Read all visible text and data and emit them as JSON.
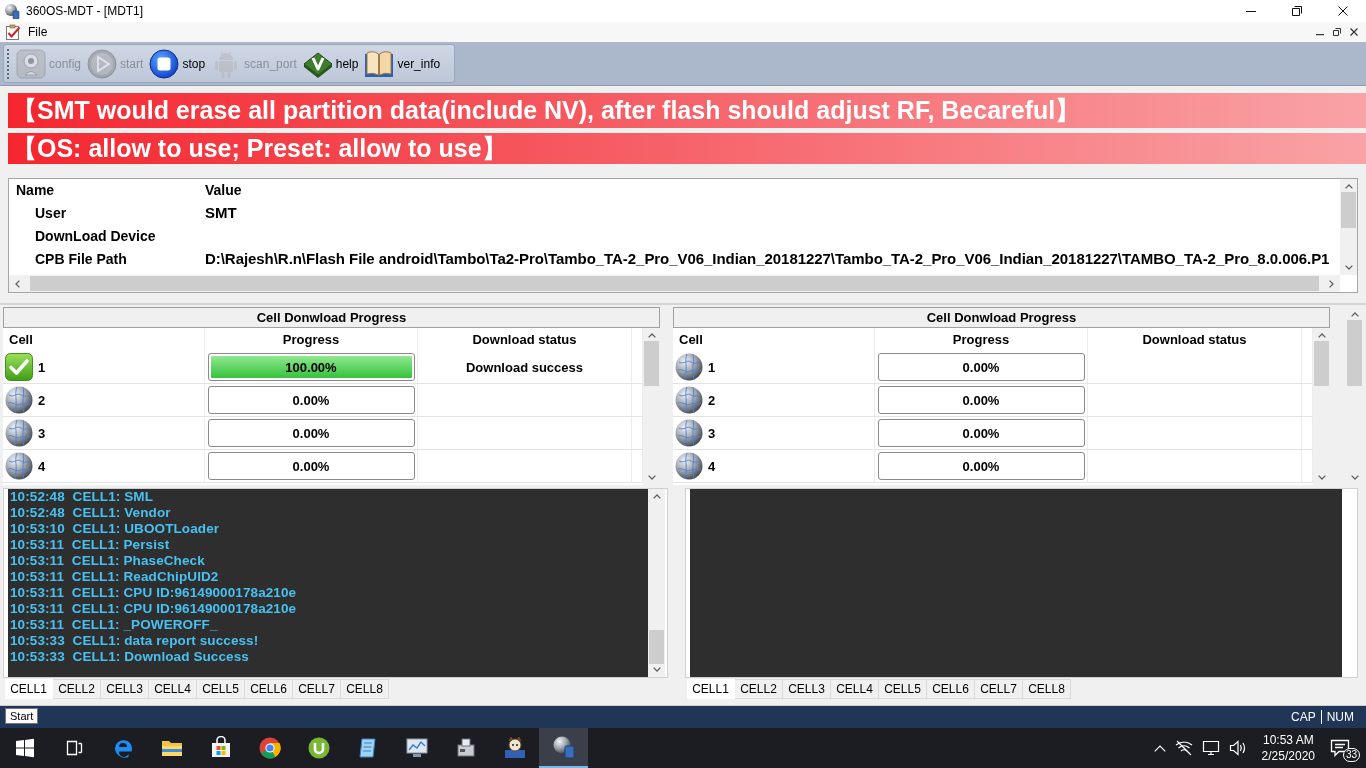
{
  "window": {
    "title": "360OS-MDT - [MDT1]"
  },
  "menu": [
    "File"
  ],
  "toolbar": [
    {
      "kind": "config",
      "label": "config",
      "disabled": true
    },
    {
      "kind": "start",
      "label": "start",
      "disabled": true
    },
    {
      "kind": "stop",
      "label": "stop",
      "disabled": false
    },
    {
      "kind": "scan",
      "label": "scan_port",
      "disabled": true
    },
    {
      "kind": "help",
      "label": "help",
      "disabled": false
    },
    {
      "kind": "info",
      "label": "ver_info",
      "disabled": false
    }
  ],
  "banners": [
    "【SMT would erase all partition data(include NV), after flash should adjust RF, Becareful】",
    "【OS: allow to use; Preset: allow to use】"
  ],
  "info_table": {
    "columns": [
      "Name",
      "Value"
    ],
    "rows": [
      {
        "name": "User",
        "value": "SMT"
      },
      {
        "name": "DownLoad Device"
      },
      {
        "name": "CPB File Path",
        "value": "D:\\Rajesh\\R.n\\Flash File android\\Tambo\\Ta2-Pro\\Tambo_TA-2_Pro_V06_Indian_20181227\\Tambo_TA-2_Pro_V06_Indian_20181227\\TAMBO_TA-2_Pro_8.0.006.P1"
      }
    ]
  },
  "progress_panels": [
    {
      "title": "Cell Donwload Progress",
      "columns": [
        "Cell",
        "Progress",
        "Download status"
      ],
      "rows": [
        {
          "cell": "1",
          "kind": "done",
          "level": 1,
          "reading": "100.00%",
          "status": "Download success"
        },
        {
          "cell": "2",
          "kind": "idle",
          "level": 0,
          "reading": "0.00%"
        },
        {
          "cell": "3",
          "kind": "idle",
          "level": 0,
          "reading": "0.00%"
        },
        {
          "cell": "4",
          "kind": "idle",
          "level": 0,
          "reading": "0.00%"
        }
      ]
    },
    {
      "title": "Cell Donwload Progress",
      "columns": [
        "Cell",
        "Progress",
        "Download status"
      ],
      "rows": [
        {
          "cell": "1",
          "kind": "idle",
          "level": 0,
          "reading": "0.00%"
        },
        {
          "cell": "2",
          "kind": "idle",
          "level": 0,
          "reading": "0.00%"
        },
        {
          "cell": "3",
          "kind": "idle",
          "level": 0,
          "reading": "0.00%"
        },
        {
          "cell": "4",
          "kind": "idle",
          "level": 0,
          "reading": "0.00%"
        }
      ]
    }
  ],
  "log_panels": [
    {
      "lines": [
        "10:52:48  CELL1: SML",
        "10:52:48  CELL1: Vendor",
        "10:53:10  CELL1: UBOOTLoader",
        "10:53:11  CELL1: Persist",
        "10:53:11  CELL1: PhaseCheck",
        "10:53:11  CELL1: ReadChipUID2",
        "10:53:11  CELL1: CPU ID:96149000178a210e",
        "10:53:11  CELL1: CPU ID:96149000178a210e",
        "10:53:11  CELL1: _POWEROFF_",
        "10:53:33  CELL1: data report success!",
        "10:53:33  CELL1: Download Success"
      ],
      "tabs": [
        {
          "label": "CELL1",
          "selected": true
        },
        {
          "label": "CELL2",
          "selected": false
        },
        {
          "label": "CELL3",
          "selected": false
        },
        {
          "label": "CELL4",
          "selected": false
        },
        {
          "label": "CELL5",
          "selected": false
        },
        {
          "label": "CELL6",
          "selected": false
        },
        {
          "label": "CELL7",
          "selected": false
        },
        {
          "label": "CELL8",
          "selected": false
        }
      ]
    },
    {
      "tabs": [
        {
          "label": "CELL1",
          "selected": true
        },
        {
          "label": "CELL2",
          "selected": false
        },
        {
          "label": "CELL3",
          "selected": false
        },
        {
          "label": "CELL4",
          "selected": false
        },
        {
          "label": "CELL5",
          "selected": false
        },
        {
          "label": "CELL6",
          "selected": false
        },
        {
          "label": "CELL7",
          "selected": false
        },
        {
          "label": "CELL8",
          "selected": false
        }
      ]
    }
  ],
  "tooltip": "Start",
  "status_bar": [
    "CAP",
    "NUM"
  ],
  "taskbar": {
    "apps": [
      {
        "kind": "start",
        "selected": false
      },
      {
        "kind": "taskview",
        "selected": false
      },
      {
        "kind": "browser",
        "selected": false
      },
      {
        "kind": "folder",
        "selected": false
      },
      {
        "kind": "store",
        "selected": false
      },
      {
        "kind": "chrome",
        "selected": false
      },
      {
        "kind": "torrent",
        "selected": false
      },
      {
        "kind": "notepad",
        "selected": false
      },
      {
        "kind": "monitor",
        "selected": false
      },
      {
        "kind": "device",
        "selected": false
      },
      {
        "kind": "character",
        "selected": false
      },
      {
        "kind": "mdt",
        "selected": true
      }
    ],
    "clock": {
      "time": "10:53 AM",
      "date": "2/25/2020"
    },
    "notification_count": "33"
  }
}
